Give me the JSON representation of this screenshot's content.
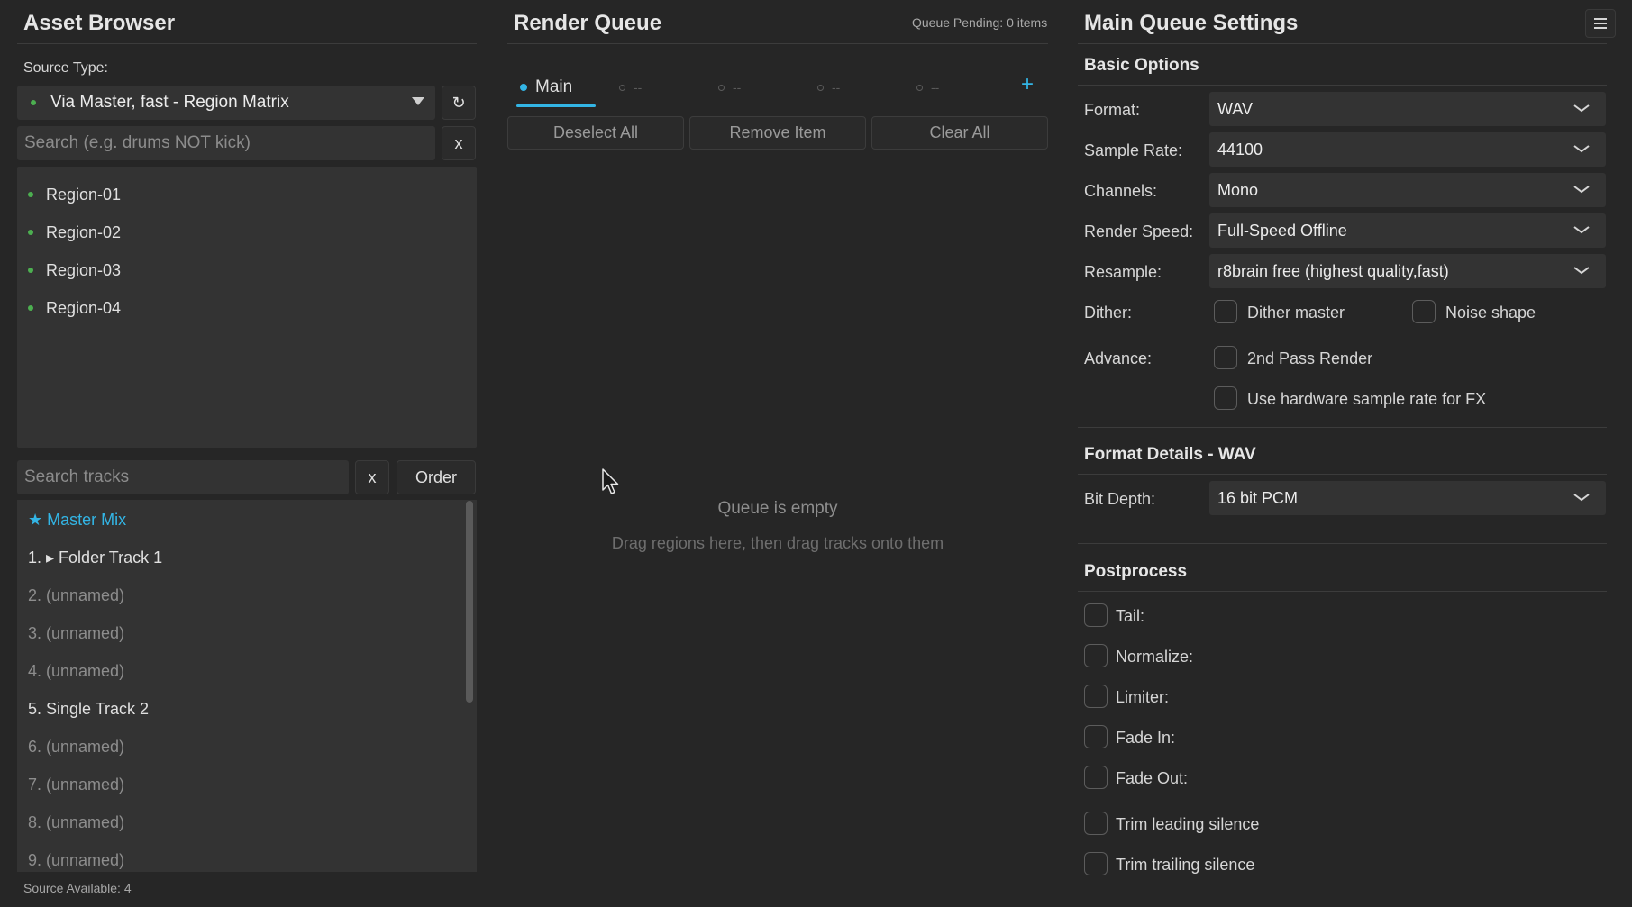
{
  "asset_browser": {
    "title": "Asset Browser",
    "source_type_label": "Source Type:",
    "source_type_value": "Via Master, fast - Region Matrix",
    "refresh_glyph": "↻",
    "region_search_placeholder": "Search (e.g. drums NOT kick)",
    "clear_glyph": "x",
    "regions": [
      "Region-01",
      "Region-02",
      "Region-03",
      "Region-04"
    ],
    "track_search_placeholder": "Search tracks",
    "order_label": "Order",
    "tracks": {
      "master": "★ Master Mix",
      "t1": "1. ▸ Folder Track 1",
      "t2": "2. (unnamed)",
      "t3": "3. (unnamed)",
      "t4": "4. (unnamed)",
      "t5": "5. Single Track 2",
      "t6": "6. (unnamed)",
      "t7": "7. (unnamed)",
      "t8": "8. (unnamed)",
      "t9": "9. (unnamed)"
    },
    "footer": "Source Available: 4"
  },
  "render_queue": {
    "title": "Render Queue",
    "pending": "Queue Pending: 0 items",
    "tabs": [
      "Main",
      "--",
      "--",
      "--",
      "--"
    ],
    "add_glyph": "+",
    "deselect_all": "Deselect All",
    "remove_item": "Remove Item",
    "clear_all": "Clear All",
    "empty_title": "Queue is empty",
    "empty_hint": "Drag regions here, then drag tracks onto them"
  },
  "settings": {
    "title": "Main Queue Settings",
    "basic_options": "Basic Options",
    "format_label": "Format:",
    "format_value": "WAV",
    "sample_rate_label": "Sample Rate:",
    "sample_rate_value": "44100",
    "channels_label": "Channels:",
    "channels_value": "Mono",
    "render_speed_label": "Render Speed:",
    "render_speed_value": "Full-Speed Offline",
    "resample_label": "Resample:",
    "resample_value": "r8brain free (highest quality,fast)",
    "dither_label": "Dither:",
    "dither_master": "Dither master",
    "noise_shape": "Noise shape",
    "advance_label": "Advance:",
    "second_pass": "2nd Pass Render",
    "hw_sample_rate": "Use hardware sample rate for FX",
    "format_details": "Format Details - WAV",
    "bit_depth_label": "Bit Depth:",
    "bit_depth_value": "16 bit PCM",
    "postprocess": "Postprocess",
    "tail": "Tail:",
    "normalize": "Normalize:",
    "limiter": "Limiter:",
    "fade_in": "Fade In:",
    "fade_out": "Fade Out:",
    "trim_leading": "Trim leading silence",
    "trim_trailing": "Trim trailing silence"
  },
  "colors": {
    "background": "#262626",
    "panel": "#333333",
    "accent": "#33b5e5",
    "region_dot": "#4caf50"
  }
}
